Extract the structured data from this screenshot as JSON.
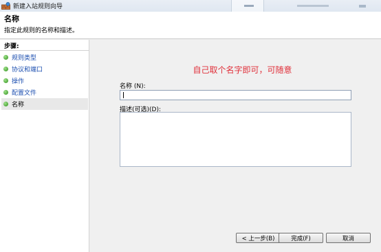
{
  "window": {
    "title": "新建入站规则向导"
  },
  "header": {
    "title": "名称",
    "subtitle": "指定此规则的名称和描述。"
  },
  "steps": {
    "heading": "步骤:",
    "items": [
      {
        "label": "规则类型",
        "current": false
      },
      {
        "label": "协议和端口",
        "current": false
      },
      {
        "label": "操作",
        "current": false
      },
      {
        "label": "配置文件",
        "current": false
      },
      {
        "label": "名称",
        "current": true
      }
    ]
  },
  "main": {
    "hint": "自己取个名字即可，可随意",
    "name_label": "名称 (N):",
    "name_value": "",
    "description_label": "描述(可选)(D):",
    "description_value": ""
  },
  "buttons": {
    "back": "< 上一步(B)",
    "finish": "完成(F)",
    "cancel": "取消"
  },
  "colors": {
    "hint": "#e0303a",
    "step_link": "#1c4fb0",
    "step_dot": "#3a9a25"
  }
}
